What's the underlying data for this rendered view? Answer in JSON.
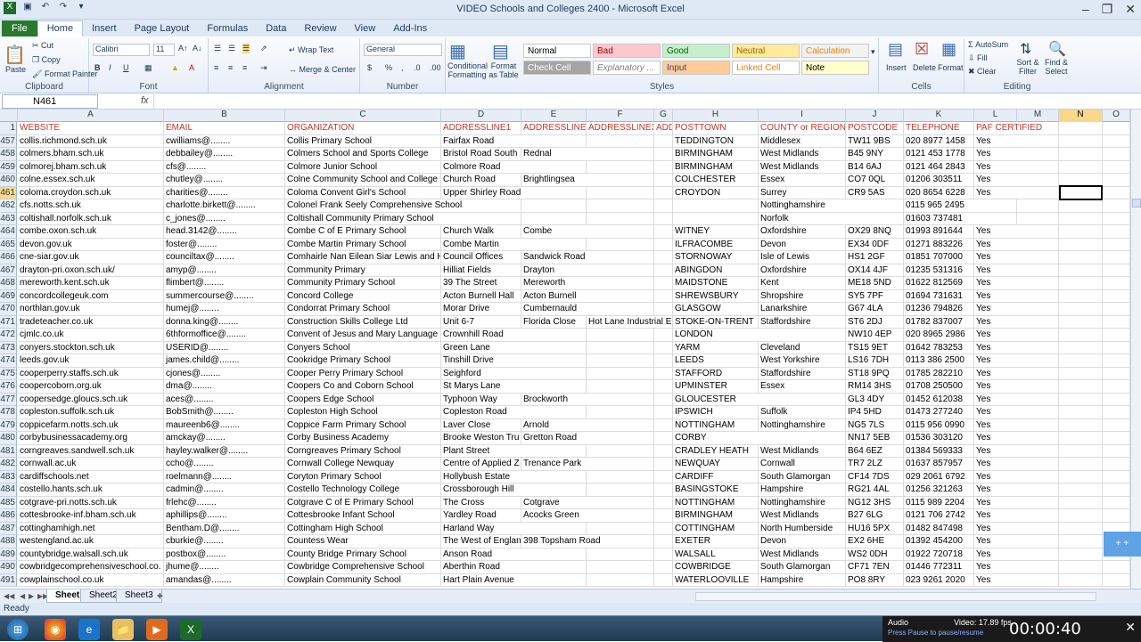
{
  "window": {
    "title": "VIDEO Schools and Colleges 2400  -  Microsoft Excel"
  },
  "ribbon_tabs": [
    "File",
    "Home",
    "Insert",
    "Page Layout",
    "Formulas",
    "Data",
    "Review",
    "View",
    "Add-Ins"
  ],
  "clipboard": {
    "paste": "Paste",
    "cut": "Cut",
    "copy": "Copy",
    "format_painter": "Format Painter",
    "label": "Clipboard"
  },
  "font": {
    "name": "Calibri",
    "size": "11",
    "label": "Font"
  },
  "alignment": {
    "wrap": "Wrap Text",
    "merge": "Merge & Center",
    "label": "Alignment"
  },
  "number": {
    "format": "General",
    "label": "Number"
  },
  "styles": {
    "cond": "Conditional Formatting",
    "table": "Format as Table",
    "label": "Styles",
    "cells": [
      {
        "t": "Normal",
        "bg": "#ffffff",
        "fg": "#000000"
      },
      {
        "t": "Bad",
        "bg": "#ffc7ce",
        "fg": "#9c0006"
      },
      {
        "t": "Good",
        "bg": "#c6efce",
        "fg": "#006100"
      },
      {
        "t": "Neutral",
        "bg": "#ffeb9c",
        "fg": "#9c6500"
      },
      {
        "t": "Calculation",
        "bg": "#f2f2f2",
        "fg": "#fa7d00"
      },
      {
        "t": "Check Cell",
        "bg": "#a5a5a5",
        "fg": "#ffffff"
      },
      {
        "t": "Explanatory ...",
        "bg": "#ffffff",
        "fg": "#7f7f7f"
      },
      {
        "t": "Input",
        "bg": "#ffcc99",
        "fg": "#3f3f76"
      },
      {
        "t": "Linked Cell",
        "bg": "#ffffff",
        "fg": "#fa7d00"
      },
      {
        "t": "Note",
        "bg": "#ffffcc",
        "fg": "#000000"
      }
    ]
  },
  "cells_grp": {
    "insert": "Insert",
    "delete": "Delete",
    "format": "Format",
    "label": "Cells"
  },
  "editing": {
    "autosum": "AutoSum",
    "fill": "Fill",
    "clear": "Clear",
    "sort": "Sort & Filter",
    "find": "Find & Select",
    "label": "Editing"
  },
  "formula_bar": {
    "name_box": "N461",
    "fx": "fx"
  },
  "columns": [
    "A",
    "B",
    "C",
    "D",
    "E",
    "F",
    "G",
    "H",
    "I",
    "J",
    "K",
    "L",
    "M",
    "N",
    "O"
  ],
  "header_row": {
    "num": "1",
    "cells": [
      "WEBSITE",
      "EMAIL",
      "ORGANIZATION",
      "ADDRESSLINE1",
      "ADDRESSLINE2",
      "ADDRESSLINE3",
      "ADD",
      "POSTTOWN",
      "COUNTY or REGION",
      "POSTCODE",
      "TELEPHONE",
      "PAF CERTIFIED",
      "",
      "",
      ""
    ]
  },
  "rows": [
    [
      "457",
      "collis.richmond.sch.uk",
      "cwilliams@........",
      "Collis Primary School",
      "Fairfax Road",
      "",
      "",
      "",
      "TEDDINGTON",
      "Middlesex",
      "TW11 9BS",
      "020 8977 1458",
      "Yes"
    ],
    [
      "458",
      "colmers.bham.sch.uk",
      "debbailey@........",
      "Colmers School and Sports College",
      "Bristol Road South",
      "Rednal",
      "",
      "",
      "BIRMINGHAM",
      "West Midlands",
      "B45 9NY",
      "0121 453 1778",
      "Yes"
    ],
    [
      "459",
      "colmorej.bham.sch.uk",
      "cfs@........",
      "Colmore Junior School",
      "Colmore Road",
      "",
      "",
      "",
      "BIRMINGHAM",
      "West Midlands",
      "B14 6AJ",
      "0121 464 2843",
      "Yes"
    ],
    [
      "460",
      "colne.essex.sch.uk",
      "chutley@........",
      "Colne Community School and College",
      "Church Road",
      "Brightlingsea",
      "",
      "",
      "COLCHESTER",
      "Essex",
      "CO7 0QL",
      "01206 303511",
      "Yes"
    ],
    [
      "461",
      "coloma.croydon.sch.uk",
      "charities@........",
      "Coloma Convent Girl's School",
      "Upper Shirley Road",
      "",
      "",
      "",
      "CROYDON",
      "Surrey",
      "CR9 5AS",
      "020 8654 6228",
      "Yes"
    ],
    [
      "462",
      "cfs.notts.sch.uk",
      "charlotte.birkett@........",
      "Colonel Frank Seely Comprehensive School",
      "",
      "",
      "",
      "",
      "",
      "Nottinghamshire",
      "",
      "0115 965 2495",
      ""
    ],
    [
      "463",
      "coltishall.norfolk.sch.uk",
      "c_jones@........",
      "Coltishall Community Primary School",
      "",
      "",
      "",
      "",
      "",
      "Norfolk",
      "",
      "01603 737481",
      ""
    ],
    [
      "464",
      "combe.oxon.sch.uk",
      "head.3142@........",
      "Combe C of E Primary School",
      "Church Walk",
      "Combe",
      "",
      "",
      "WITNEY",
      "Oxfordshire",
      "OX29 8NQ",
      "01993 891644",
      "Yes"
    ],
    [
      "465",
      "devon.gov.uk",
      "foster@........",
      "Combe Martin Primary School",
      "Combe Martin",
      "",
      "",
      "",
      "ILFRACOMBE",
      "Devon",
      "EX34 0DF",
      "01271 883226",
      "Yes"
    ],
    [
      "466",
      "cne-siar.gov.uk",
      "counciltax@........",
      "Comhairle Nan Eilean Siar Lewis and H",
      "Council Offices",
      "Sandwick Road",
      "",
      "",
      "STORNOWAY",
      "Isle of Lewis",
      "HS1 2GF",
      "01851 707000",
      "Yes"
    ],
    [
      "467",
      "drayton-pri.oxon.sch.uk/",
      "amyp@........",
      "Community Primary",
      "Hilliat Fields",
      "Drayton",
      "",
      "",
      "ABINGDON",
      "Oxfordshire",
      "OX14 4JF",
      "01235 531316",
      "Yes"
    ],
    [
      "468",
      "mereworth.kent.sch.uk",
      "flimbert@........",
      "Community Primary School",
      "39 The Street",
      "Mereworth",
      "",
      "",
      "MAIDSTONE",
      "Kent",
      "ME18 5ND",
      "01622 812569",
      "Yes"
    ],
    [
      "469",
      "concordcollegeuk.com",
      "summercourse@........",
      "Concord College",
      "Acton Burnell Hall",
      "Acton Burnell",
      "",
      "",
      "SHREWSBURY",
      "Shropshire",
      "SY5 7PF",
      "01694 731631",
      "Yes"
    ],
    [
      "470",
      "northlan.gov.uk",
      "humej@........",
      "Condorrat Primary School",
      "Morar Drive",
      "Cumbernauld",
      "",
      "",
      "GLASGOW",
      "Lanarkshire",
      "G67 4LA",
      "01236 794826",
      "Yes"
    ],
    [
      "471",
      "tradeteacher.co.uk",
      "donna.king@........",
      "Construction Skills College Ltd",
      "Unit 6-7",
      "Florida Close",
      "Hot Lane Industrial E",
      "",
      "STOKE-ON-TRENT",
      "Staffordshire",
      "ST6 2DJ",
      "01782 837007",
      "Yes"
    ],
    [
      "472",
      "cjmlc.co.uk",
      "6thformoffice@........",
      "Convent of Jesus and Mary Language C",
      "Crownhill Road",
      "",
      "",
      "",
      "LONDON",
      "",
      "NW10 4EP",
      "020 8965 2986",
      "Yes"
    ],
    [
      "473",
      "conyers.stockton.sch.uk",
      "USERID@........",
      "Conyers School",
      "Green Lane",
      "",
      "",
      "",
      "YARM",
      "Cleveland",
      "TS15 9ET",
      "01642 783253",
      "Yes"
    ],
    [
      "474",
      "leeds.gov.uk",
      "james.child@........",
      "Cookridge Primary School",
      "Tinshill Drive",
      "",
      "",
      "",
      "LEEDS",
      "West Yorkshire",
      "LS16 7DH",
      "0113 386 2500",
      "Yes"
    ],
    [
      "475",
      "cooperperry.staffs.sch.uk",
      "cjones@........",
      "Cooper Perry Primary School",
      "Seighford",
      "",
      "",
      "",
      "STAFFORD",
      "Staffordshire",
      "ST18 9PQ",
      "01785 282210",
      "Yes"
    ],
    [
      "476",
      "coopercoborn.org.uk",
      "dma@........",
      "Coopers Co and Coborn School",
      "St Marys Lane",
      "",
      "",
      "",
      "UPMINSTER",
      "Essex",
      "RM14 3HS",
      "01708 250500",
      "Yes"
    ],
    [
      "477",
      "coopersedge.gloucs.sch.uk",
      "aces@........",
      "Coopers Edge School",
      "Typhoon Way",
      "Brockworth",
      "",
      "",
      "GLOUCESTER",
      "",
      "GL3 4DY",
      "01452 612038",
      "Yes"
    ],
    [
      "478",
      "copleston.suffolk.sch.uk",
      "BobSmith@........",
      "Copleston High School",
      "Copleston Road",
      "",
      "",
      "",
      "IPSWICH",
      "Suffolk",
      "IP4 5HD",
      "01473 277240",
      "Yes"
    ],
    [
      "479",
      "coppicefarm.notts.sch.uk",
      "maureenb6@........",
      "Coppice Farm Primary School",
      "Laver Close",
      "Arnold",
      "",
      "",
      "NOTTINGHAM",
      "Nottinghamshire",
      "NG5 7LS",
      "0115 956 0990",
      "Yes"
    ],
    [
      "480",
      "corbybusinessacademy.org",
      "amckay@........",
      "Corby Business Academy",
      "Brooke Weston Tru",
      "Gretton Road",
      "",
      "",
      "CORBY",
      "",
      "NN17 5EB",
      "01536 303120",
      "Yes"
    ],
    [
      "481",
      "corngreaves.sandwell.sch.uk",
      "hayley.walker@........",
      "Corngreaves Primary School",
      "Plant Street",
      "",
      "",
      "",
      "CRADLEY HEATH",
      "West Midlands",
      "B64 6EZ",
      "01384 569333",
      "Yes"
    ],
    [
      "482",
      "cornwall.ac.uk",
      "ccho@........",
      "Cornwall College Newquay",
      "Centre of Applied Z",
      "Trenance Park",
      "",
      "",
      "NEWQUAY",
      "Cornwall",
      "TR7 2LZ",
      "01637 857957",
      "Yes"
    ],
    [
      "483",
      "cardiffschools.net",
      "roelmann@........",
      "Coryton Primary School",
      "Hollybush Estate",
      "",
      "",
      "",
      "CARDIFF",
      "South Glamorgan",
      "CF14 7DS",
      "029 2061 6792",
      "Yes"
    ],
    [
      "484",
      "costello.hants.sch.uk",
      "cadmin@........",
      "Costello Technology College",
      "Crossborough Hill",
      "",
      "",
      "",
      "BASINGSTOKE",
      "Hampshire",
      "RG21 4AL",
      "01256 321263",
      "Yes"
    ],
    [
      "485",
      "cotgrave-pri.notts.sch.uk",
      "frlehc@........",
      "Cotgrave C of E Primary School",
      "The Cross",
      "Cotgrave",
      "",
      "",
      "NOTTINGHAM",
      "Nottinghamshire",
      "NG12 3HS",
      "0115 989 2204",
      "Yes"
    ],
    [
      "486",
      "cottesbrooke-inf.bham.sch.uk",
      "aphillips@........",
      "Cottesbrooke Infant School",
      "Yardley Road",
      "Acocks Green",
      "",
      "",
      "BIRMINGHAM",
      "West Midlands",
      "B27 6LG",
      "0121 706 2742",
      "Yes"
    ],
    [
      "487",
      "cottinghamhigh.net",
      "Bentham.D@........",
      "Cottingham High School",
      "Harland Way",
      "",
      "",
      "",
      "COTTINGHAM",
      "North Humberside",
      "HU16 5PX",
      "01482 847498",
      "Yes"
    ],
    [
      "488",
      "westengland.ac.uk",
      "cburkie@........",
      "Countess Wear",
      "The West of Englan",
      "398 Topsham Road",
      "",
      "",
      "EXETER",
      "Devon",
      "EX2 6HE",
      "01392 454200",
      "Yes"
    ],
    [
      "489",
      "countybridge.walsall.sch.uk",
      "postbox@........",
      "County Bridge Primary School",
      "Anson Road",
      "",
      "",
      "",
      "WALSALL",
      "West Midlands",
      "WS2 0DH",
      "01922 720718",
      "Yes"
    ],
    [
      "490",
      "cowbridgecomprehensiveschool.co.",
      "jhume@........",
      "Cowbridge Comprehensive School",
      "Aberthin Road",
      "",
      "",
      "",
      "COWBRIDGE",
      "South Glamorgan",
      "CF71 7EN",
      "01446 772311",
      "Yes"
    ],
    [
      "491",
      "cowplainschool.co.uk",
      "amandas@........",
      "Cowplain Community School",
      "Hart Plain Avenue",
      "",
      "",
      "",
      "WATERLOOVILLE",
      "Hampshire",
      "PO8 8RY",
      "023 9261 2020",
      "Yes"
    ]
  ],
  "sheets": [
    "Sheet1",
    "Sheet2",
    "Sheet3"
  ],
  "status": {
    "ready": "Ready"
  },
  "recorder": {
    "audio": "Audio",
    "video": "Video: 17.89 fps",
    "hint": "Press Pause to pause/resume",
    "time": "00:00:40"
  }
}
